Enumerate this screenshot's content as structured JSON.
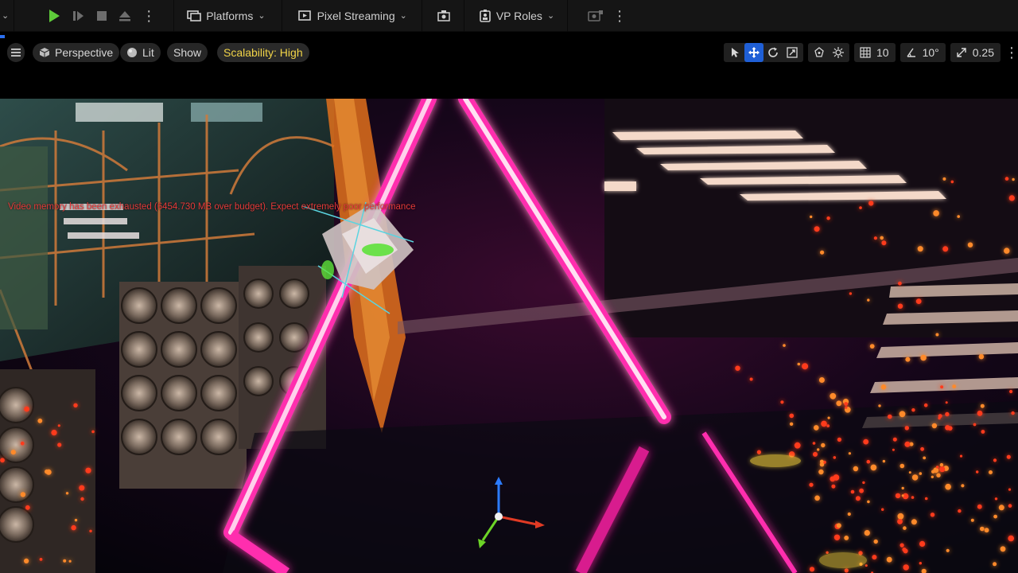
{
  "toolbar": {
    "platforms_label": "Platforms",
    "pixel_streaming_label": "Pixel Streaming",
    "vp_roles_label": "VP Roles"
  },
  "viewport": {
    "perspective_label": "Perspective",
    "lit_label": "Lit",
    "show_label": "Show",
    "scalability_label": "Scalability: High",
    "grid_snap_value": "10",
    "rotation_snap_value": "10°",
    "scale_snap_value": "0.25"
  },
  "scene": {
    "warning_text": "Video memory has been exhausted (6454.730 MB over budget). Expect extremely poor performance"
  },
  "colors": {
    "accent_blue": "#1f5fd6",
    "scalability_yellow": "#f1d448",
    "neon_pink": "#ff2fae",
    "warning_red": "#e53a3a",
    "play_green": "#5ecb3a"
  }
}
